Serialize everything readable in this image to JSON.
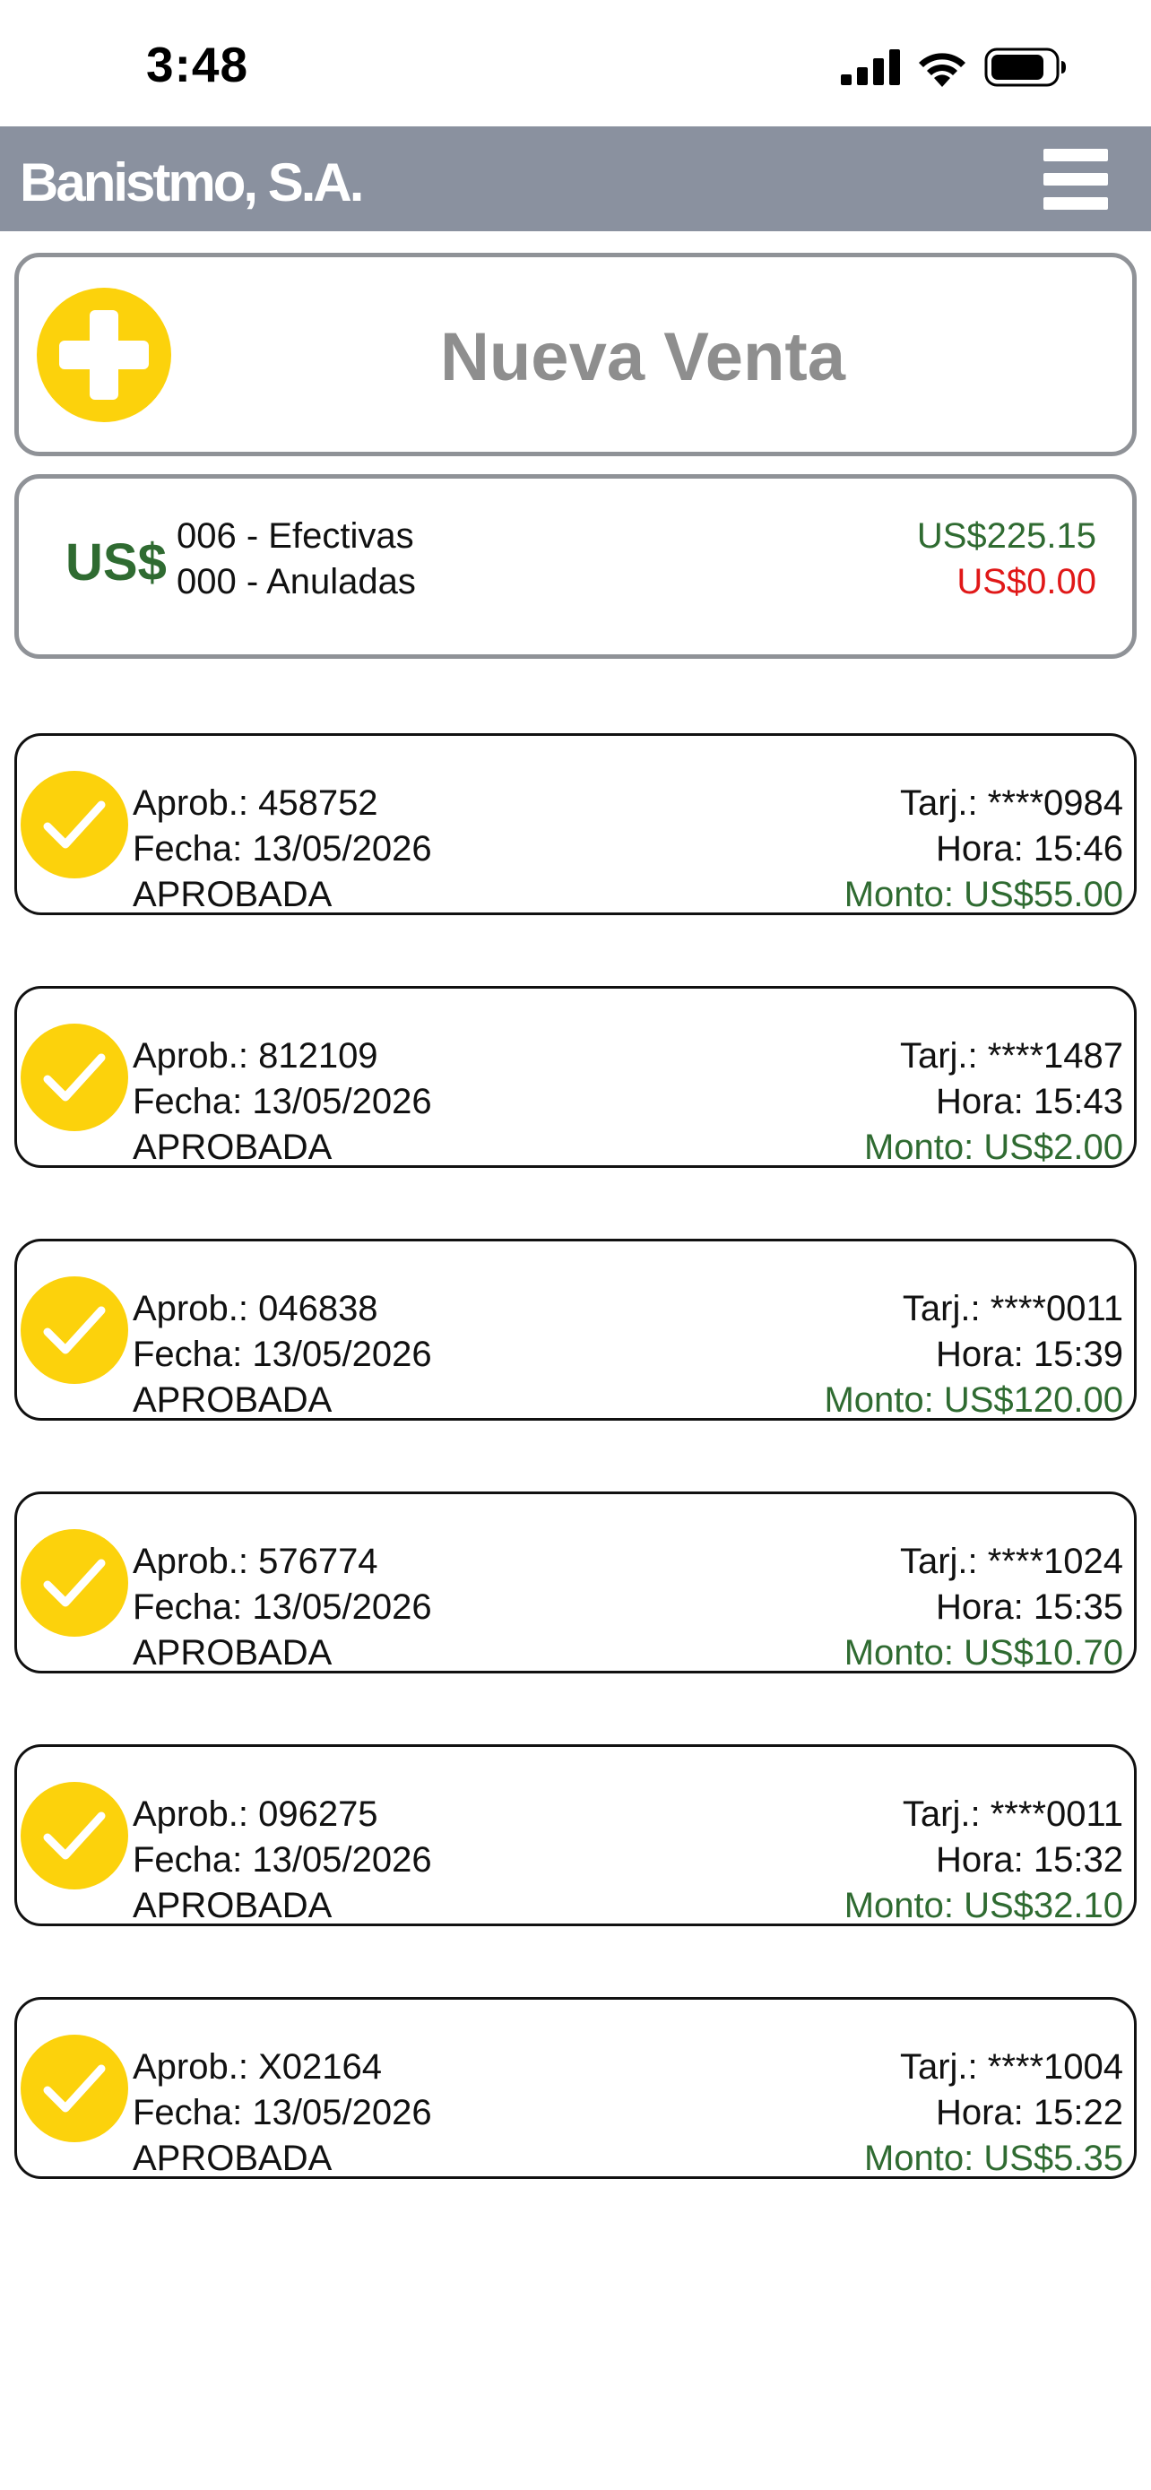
{
  "status_bar": {
    "time": "3:48",
    "icons": [
      "cellular-signal-icon",
      "wifi-icon",
      "battery-icon"
    ]
  },
  "header": {
    "title": "Banistmo, S.A.",
    "menu_icon": "hamburger-menu-icon",
    "background_color": "#8a919f"
  },
  "new_sale": {
    "label": "Nueva Venta",
    "icon": "plus-circle-icon",
    "icon_color": "#fcd20c"
  },
  "summary": {
    "currency": "US$",
    "effective_label": "006 - Efectivas",
    "effective_amount": "US$225.15",
    "voided_label": "000 - Anuladas",
    "voided_amount": "US$0.00",
    "positive_color": "#2f6b31",
    "negative_color": "#e01818"
  },
  "transactions": [
    {
      "aprob": "Aprob.: 458752",
      "fecha": "Fecha: 13/05/2026",
      "estado": "APROBADA",
      "tarj": "Tarj.: ****0984",
      "hora": "Hora: 15:46",
      "monto": "Monto: US$55.00"
    },
    {
      "aprob": "Aprob.: 812109",
      "fecha": "Fecha: 13/05/2026",
      "estado": "APROBADA",
      "tarj": "Tarj.: ****1487",
      "hora": "Hora: 15:43",
      "monto": "Monto: US$2.00"
    },
    {
      "aprob": "Aprob.: 046838",
      "fecha": "Fecha: 13/05/2026",
      "estado": "APROBADA",
      "tarj": "Tarj.: ****0011",
      "hora": "Hora: 15:39",
      "monto": "Monto: US$120.00"
    },
    {
      "aprob": "Aprob.: 576774",
      "fecha": "Fecha: 13/05/2026",
      "estado": "APROBADA",
      "tarj": "Tarj.: ****1024",
      "hora": "Hora: 15:35",
      "monto": "Monto: US$10.70"
    },
    {
      "aprob": "Aprob.: 096275",
      "fecha": "Fecha: 13/05/2026",
      "estado": "APROBADA",
      "tarj": "Tarj.: ****0011",
      "hora": "Hora: 15:32",
      "monto": "Monto: US$32.10"
    },
    {
      "aprob": "Aprob.: X02164",
      "fecha": "Fecha: 13/05/2026",
      "estado": "APROBADA",
      "tarj": "Tarj.: ****1004",
      "hora": "Hora: 15:22",
      "monto": "Monto: US$5.35"
    }
  ]
}
